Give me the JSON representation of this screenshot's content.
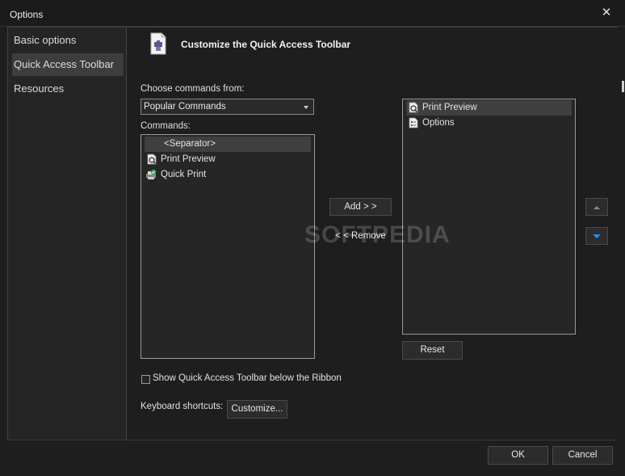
{
  "window": {
    "title": "Options"
  },
  "sidebar": {
    "items": [
      {
        "label": "Basic options"
      },
      {
        "label": "Quick Access Toolbar"
      },
      {
        "label": "Resources"
      }
    ]
  },
  "header": {
    "title": "Customize the Quick Access Toolbar"
  },
  "choose": {
    "label": "Choose commands from:",
    "value": "Popular Commands"
  },
  "commands": {
    "label": "Commands:",
    "items": [
      {
        "label": "<Separator>"
      },
      {
        "label": "Print Preview"
      },
      {
        "label": "Quick Print"
      }
    ]
  },
  "toolbar_list": {
    "items": [
      {
        "label": "Print Preview"
      },
      {
        "label": "Options"
      }
    ]
  },
  "buttons": {
    "add": "Add > >",
    "remove": "< < Remove",
    "reset": "Reset",
    "customize": "Customize...",
    "ok": "OK",
    "cancel": "Cancel"
  },
  "options": {
    "show_below_ribbon": {
      "label": "Show Quick Access Toolbar below the Ribbon",
      "checked": false
    },
    "keyboard_label": "Keyboard shortcuts:"
  },
  "watermark": "SOFTPEDIA",
  "colors": {
    "accent": "#1e90ff",
    "background": "#1e1e1e",
    "panel": "#252525",
    "selection": "#3f3f3f"
  }
}
